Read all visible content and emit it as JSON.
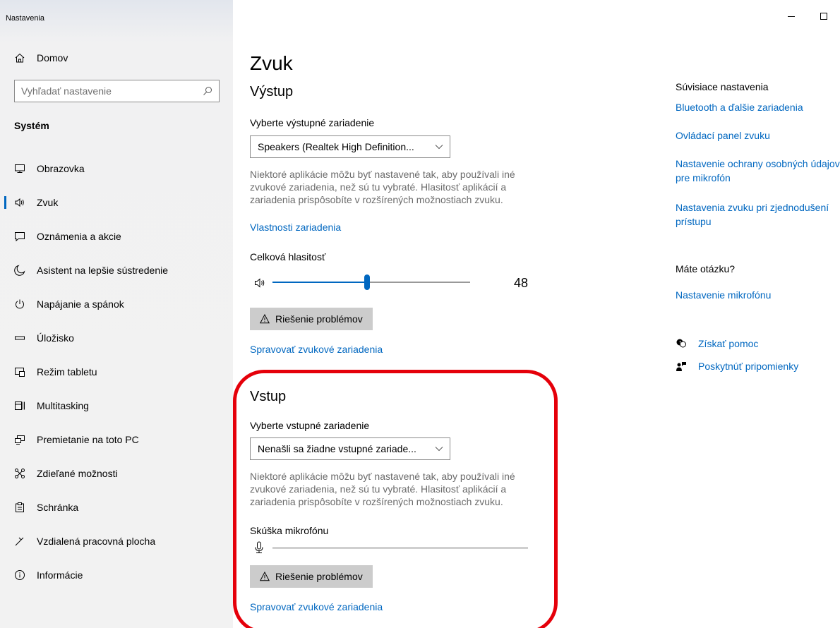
{
  "app_title": "Nastavenia",
  "window_controls": {
    "minimize": "–",
    "maximize": "☐"
  },
  "sidebar": {
    "home_label": "Domov",
    "search_placeholder": "Vyhľadať nastavenie",
    "section_title": "Systém",
    "items": [
      {
        "label": "Obrazovka",
        "icon": "monitor-icon"
      },
      {
        "label": "Zvuk",
        "icon": "speaker-icon",
        "active": true
      },
      {
        "label": "Oznámenia a akcie",
        "icon": "notification-icon"
      },
      {
        "label": "Asistent na lepšie sústredenie",
        "icon": "moon-icon"
      },
      {
        "label": "Napájanie a spánok",
        "icon": "power-icon"
      },
      {
        "label": "Úložisko",
        "icon": "storage-icon"
      },
      {
        "label": "Režim tabletu",
        "icon": "tablet-icon"
      },
      {
        "label": "Multitasking",
        "icon": "multitasking-icon"
      },
      {
        "label": "Premietanie na toto PC",
        "icon": "projecting-icon"
      },
      {
        "label": "Zdieľané možnosti",
        "icon": "shared-icon"
      },
      {
        "label": "Schránka",
        "icon": "clipboard-icon"
      },
      {
        "label": "Vzdialená pracovná plocha",
        "icon": "remote-desktop-icon"
      },
      {
        "label": "Informácie",
        "icon": "info-icon"
      }
    ]
  },
  "main": {
    "title": "Zvuk",
    "output": {
      "heading": "Výstup",
      "select_label": "Vyberte výstupné zariadenie",
      "device": "Speakers (Realtek High Definition...",
      "desc_lines": [
        "Niektoré aplikácie môžu byť nastavené tak, aby používali iné",
        "zvukové zariadenia, než sú tu vybraté. Hlasitosť aplikácií a",
        "zariadenia prispôsobíte v rozšírených možnostiach zvuku."
      ],
      "properties_link": "Vlastnosti zariadenia",
      "volume_label": "Celková hlasitosť",
      "volume_value": 48,
      "volume_display": "48",
      "troubleshoot": "Riešenie problémov",
      "manage_link": "Spravovať zvukové zariadenia"
    },
    "input": {
      "heading": "Vstup",
      "select_label": "Vyberte vstupné zariadenie",
      "device": "Nenašli sa žiadne vstupné zariade...",
      "desc_lines": [
        "Niektoré aplikácie môžu byť nastavené tak, aby používali iné",
        "zvukové zariadenia, než sú tu vybraté. Hlasitosť aplikácií a",
        "zariadenia prispôsobíte v rozšírených možnostiach zvuku."
      ],
      "mic_test_label": "Skúška mikrofónu",
      "mic_level": 0,
      "troubleshoot": "Riešenie problémov",
      "manage_link": "Spravovať zvukové zariadenia"
    }
  },
  "related": {
    "heading": "Súvisiace nastavenia",
    "links": [
      "Bluetooth a ďalšie zariadenia",
      "Ovládací panel zvuku",
      "Nastavenie ochrany osobných údajov pre mikrofón",
      "Nastavenia zvuku pri zjednodušení prístupu"
    ],
    "question_heading": "Máte otázku?",
    "question_link": "Nastavenie mikrofónu",
    "help_link": "Získať pomoc",
    "feedback_link": "Poskytnúť pripomienky"
  },
  "colors": {
    "accent": "#0067c0",
    "highlight": "#e5000a",
    "sidebar_bg": "#f2f2f2"
  }
}
